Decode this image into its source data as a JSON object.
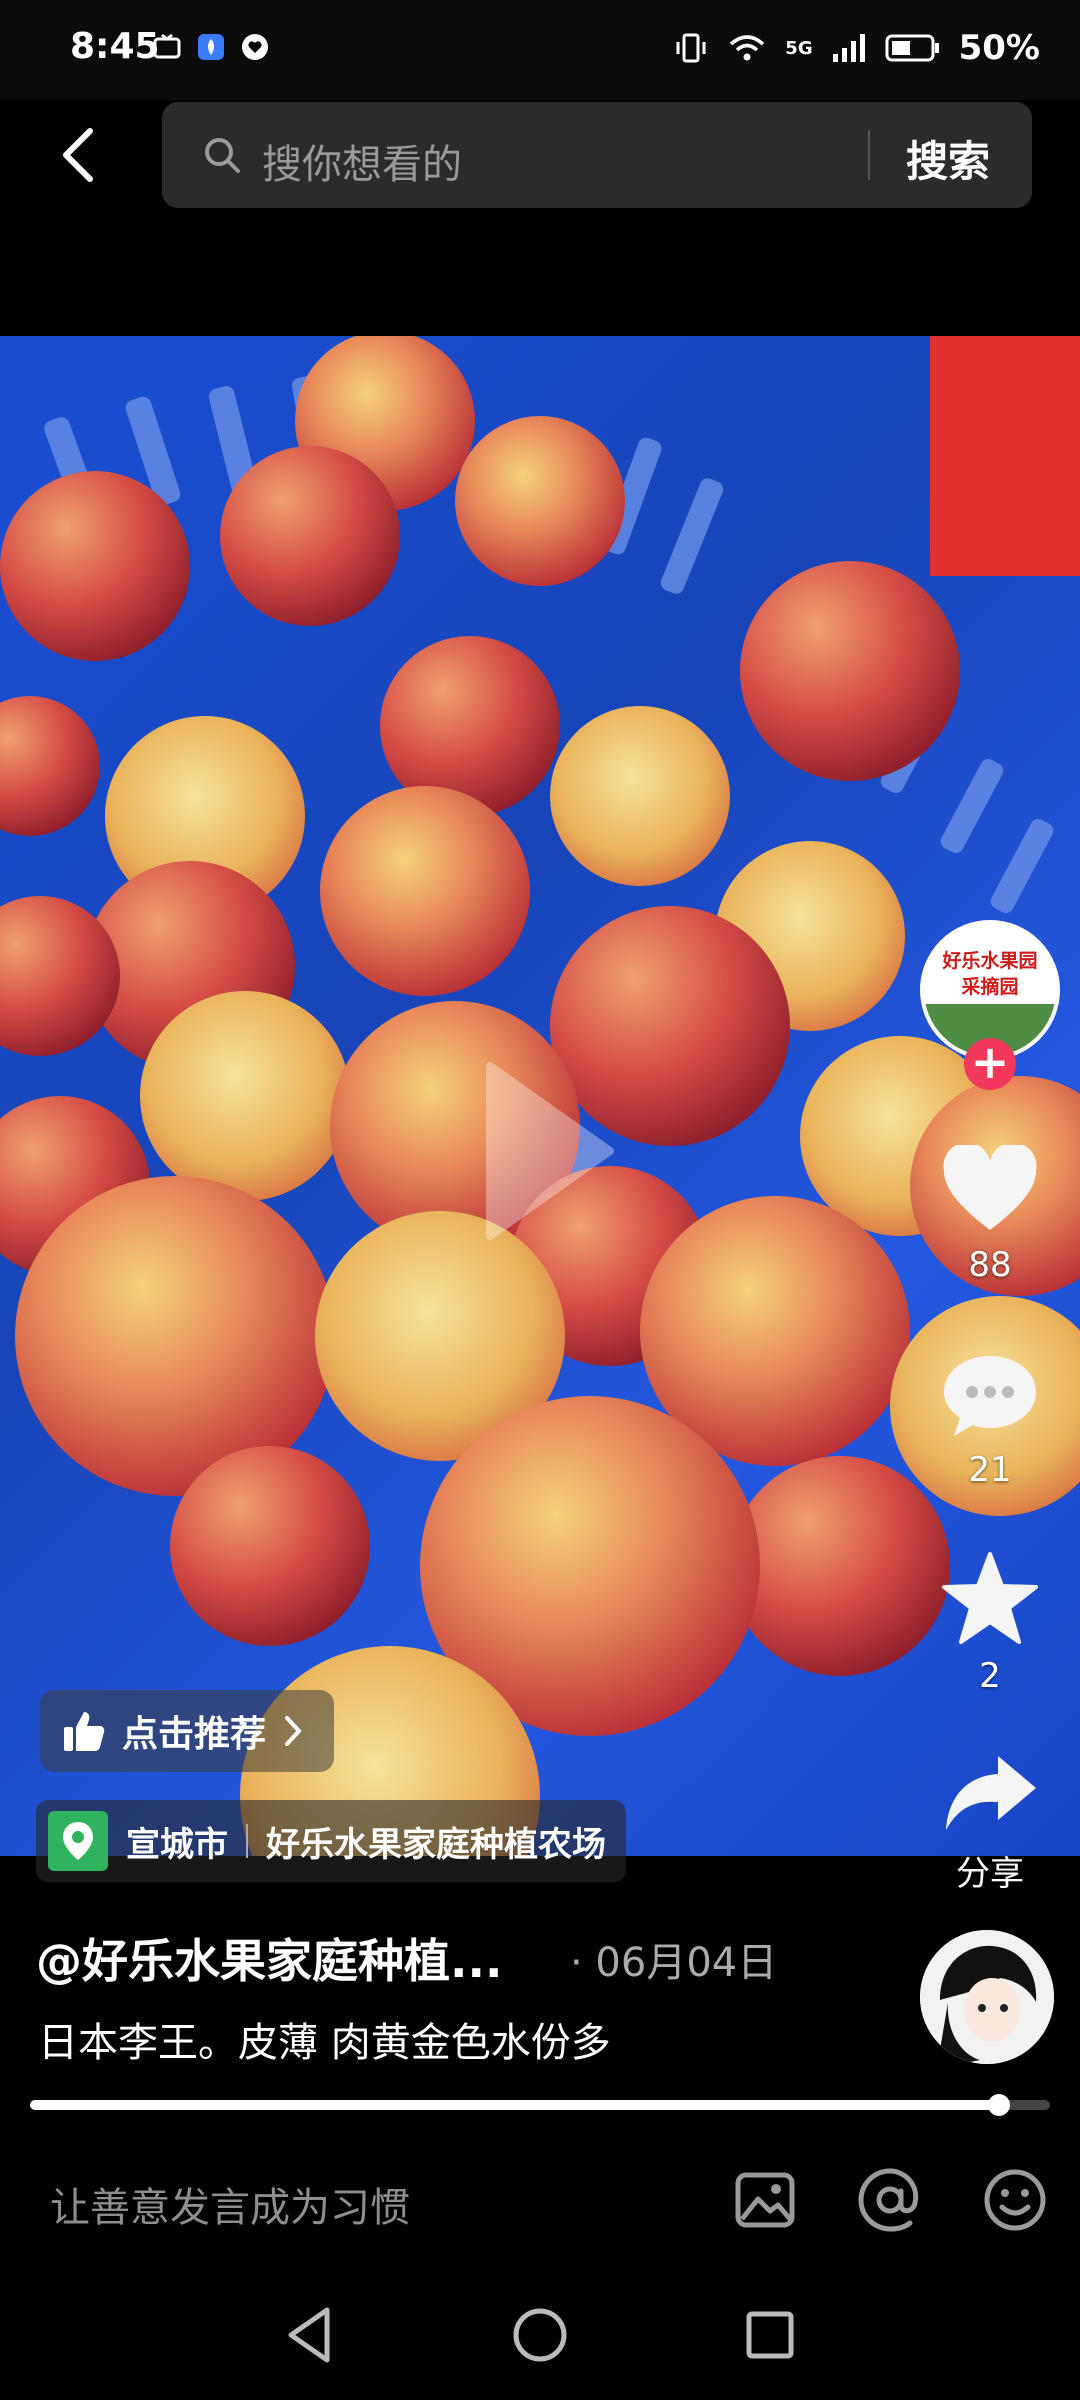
{
  "status_bar": {
    "time": "8:45",
    "network": "5G",
    "battery": "50%"
  },
  "search": {
    "placeholder": "搜你想看的",
    "button_label": "搜索"
  },
  "video": {
    "subject": "fruit-basket",
    "accent_blue": "#1a4fd4"
  },
  "actions": {
    "like_count": "88",
    "comment_count": "21",
    "favorite_count": "2",
    "share_label": "分享",
    "follow_badge_line1": "好乐水果园",
    "follow_badge_line2": "采摘园"
  },
  "recommend": {
    "label": "点击推荐"
  },
  "location": {
    "city": "宣城市",
    "place": "好乐水果家庭种植农场"
  },
  "post": {
    "author": "@好乐水果家庭种植...",
    "date": "· 06月04日",
    "description": "日本李王。皮薄 肉黄金色水份多"
  },
  "progress": {
    "fraction": 0.95
  },
  "comment": {
    "placeholder": "让善意发言成为习惯"
  },
  "colors": {
    "follow_red": "#f2385b",
    "location_green": "#2fb35d"
  }
}
